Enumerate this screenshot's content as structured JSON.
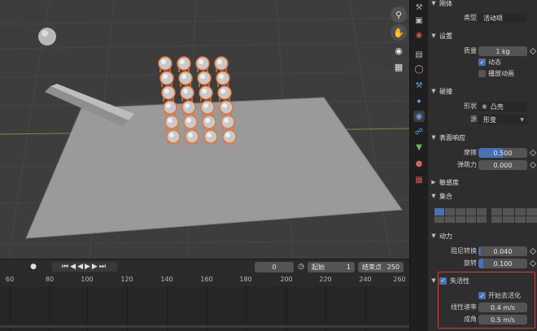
{
  "viewport": {
    "nav_icons": [
      "zoom-icon",
      "hand-pan-icon",
      "camera-icon",
      "grid-icon"
    ]
  },
  "timeline": {
    "current_frame": "0",
    "start_label": "起始",
    "start_value": "1",
    "end_label": "结束点",
    "end_value": "250",
    "ruler": [
      "60",
      "80",
      "100",
      "120",
      "140",
      "160",
      "180",
      "200",
      "220",
      "240",
      "260"
    ]
  },
  "props": {
    "rigid_body": {
      "title": "刚体",
      "type_label": "类型",
      "type_value": "活动项"
    },
    "settings": {
      "title": "设置",
      "mass_label": "质量",
      "mass_value": "1 kg",
      "dynamic_label": "动态",
      "dynamic_checked": true,
      "animated_label": "播放动画",
      "animated_checked": false
    },
    "collisions": {
      "title": "碰撞",
      "shape_label": "形状",
      "shape_value": "凸壳",
      "source_label": "源",
      "source_value": "形变"
    },
    "surface": {
      "title": "表面响应",
      "friction_label": "摩擦",
      "friction_value": "0.500",
      "friction_fraction": 0.5,
      "bounce_label": "弹跳力",
      "bounce_value": "0.000"
    },
    "sensitivity": {
      "title": "敏感度"
    },
    "collections": {
      "title": "集合"
    },
    "dynamics": {
      "title": "动力",
      "damping_translation_label": "阻尼转换",
      "damping_translation_value": "0.040",
      "damping_translation_fraction": 0.04,
      "rotation_label": "旋转",
      "rotation_value": "0.100",
      "rotation_fraction": 0.1
    },
    "deactivation": {
      "title": "失活性",
      "checked": true,
      "start_deactivated_label": "开始去活化",
      "start_deactivated_checked": true,
      "linear_velocity_label": "线性速率",
      "linear_velocity_value": "0.4 m/s",
      "angular_label": "成角",
      "angular_value": "0.5 m/s"
    }
  },
  "colors": {
    "accent": "#4772b3",
    "highlight_box": "#e03a3a",
    "selection_outline": "#e8743b"
  }
}
